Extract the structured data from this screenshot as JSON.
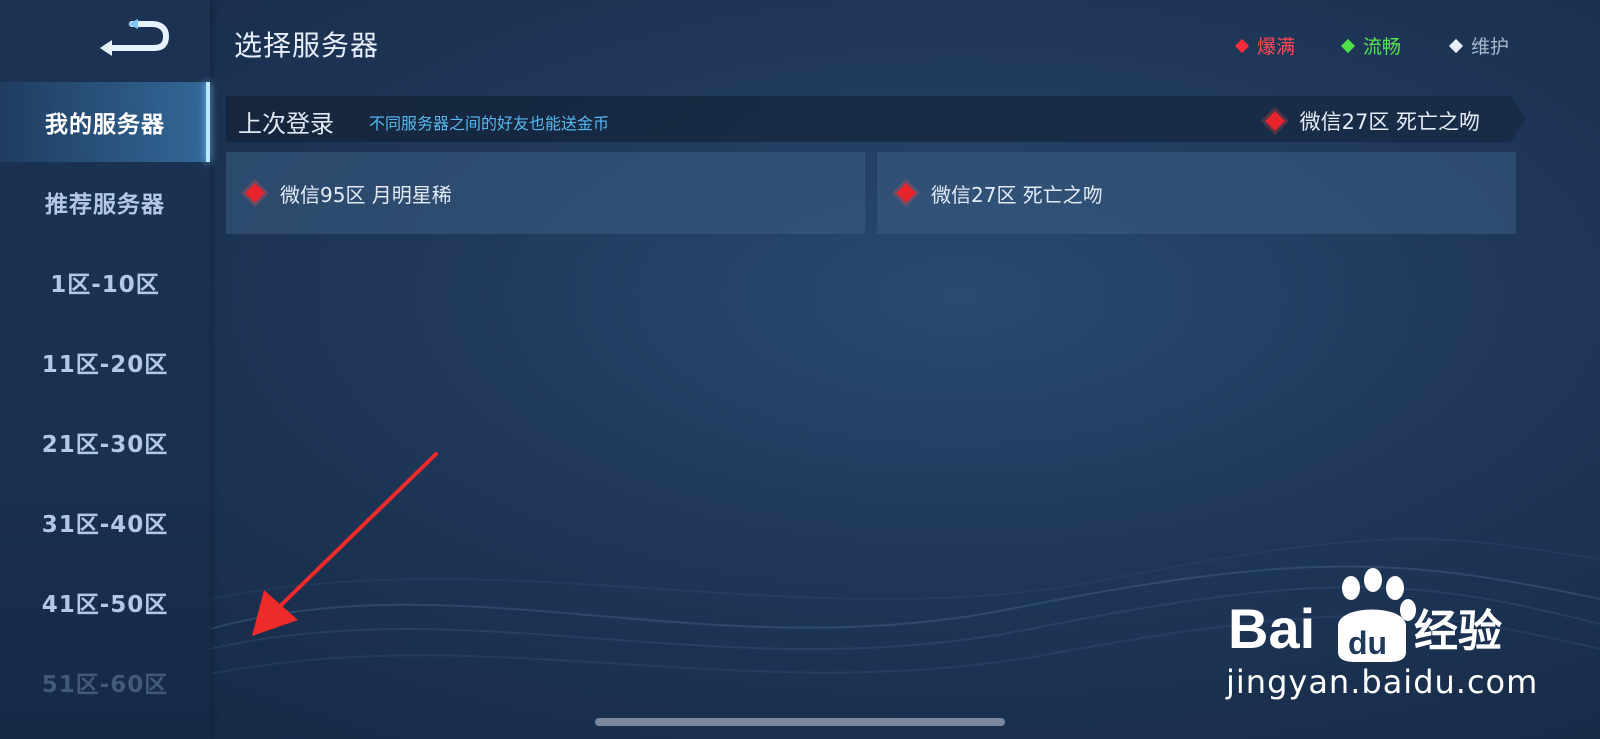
{
  "header": {
    "title": "选择服务器"
  },
  "legend": [
    {
      "label": "爆满",
      "color": "#ff4a55"
    },
    {
      "label": "流畅",
      "color": "#58e64f"
    },
    {
      "label": "维护",
      "color": "#a9b8cc"
    }
  ],
  "sidebar": {
    "items": [
      {
        "label": "我的服务器",
        "active": true
      },
      {
        "label": "推荐服务器"
      },
      {
        "label": "1区-10区"
      },
      {
        "label": "11区-20区"
      },
      {
        "label": "21区-30区"
      },
      {
        "label": "31区-40区"
      },
      {
        "label": "41区-50区"
      },
      {
        "label": "51区-60区"
      }
    ]
  },
  "last_login": {
    "label": "上次登录",
    "hint": "不同服务器之间的好友也能送金币",
    "server": "微信27区 死亡之吻",
    "status_color": "#e8232b"
  },
  "servers": [
    {
      "name": "微信95区 月明星稀",
      "status_color": "#e8232b"
    },
    {
      "name": "微信27区 死亡之吻",
      "status_color": "#e8232b"
    }
  ],
  "watermark": {
    "brand": "Bai du 经验",
    "url": "jingyan.baidu.com"
  },
  "icons": {
    "back": "back-arrow-icon",
    "status": "diamond-icon"
  }
}
